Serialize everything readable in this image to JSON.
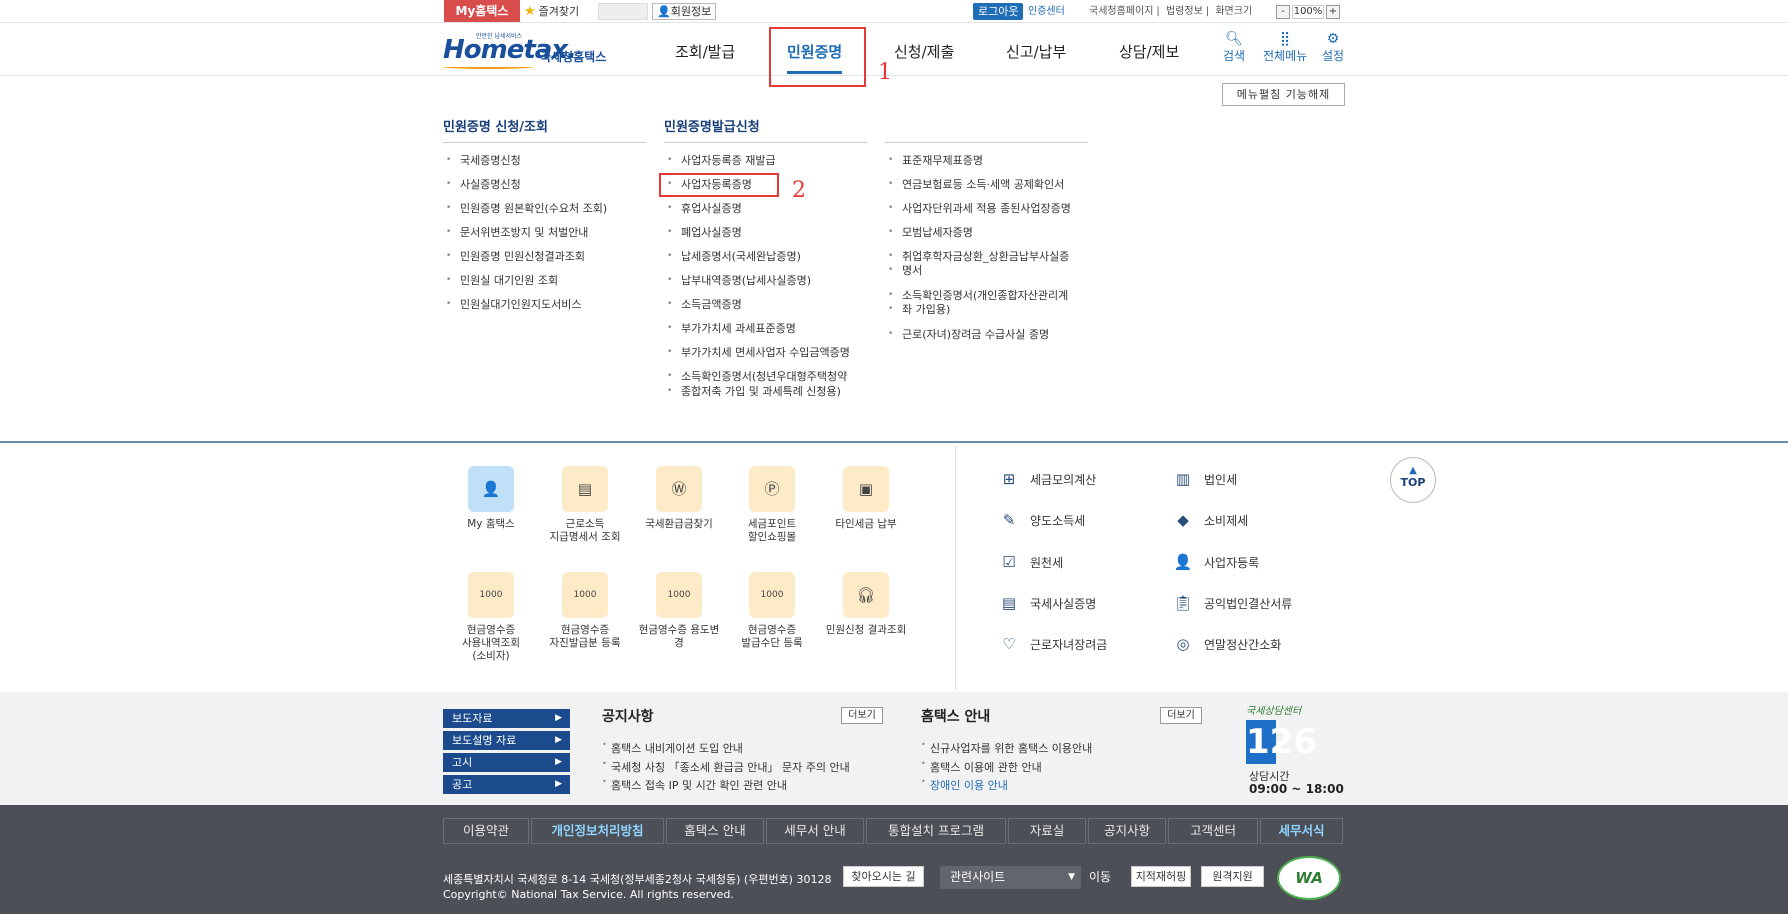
{
  "topbar": {
    "my_hometax": "My홈택스",
    "favorites": "즐겨찾기",
    "member_info": "회원정보",
    "logout": "로그아웃",
    "cert_center": "인증센터",
    "links": [
      "국세청홈페이지",
      "법령정보",
      "화면크기"
    ],
    "zoom_minus": "-",
    "zoom_value": "100%",
    "zoom_plus": "+"
  },
  "header": {
    "logo_text": "Hometax.",
    "logo_sub": "국세청홈택스",
    "logo_small": "만만한 납세서비스",
    "nav": [
      "조회/발급",
      "민원증명",
      "신청/제출",
      "신고/납부",
      "상담/제보"
    ],
    "active_nav": "민원증명",
    "icons": [
      {
        "label": "검색",
        "icon": "search-icon"
      },
      {
        "label": "전체메뉴",
        "icon": "grid-icon"
      },
      {
        "label": "설정",
        "icon": "gear-icon"
      }
    ],
    "annotation_1": "1"
  },
  "megamenu": {
    "collapse_label": "메뉴펼침 기능해제",
    "col1": {
      "title": "민원증명 신청/조회",
      "items": [
        "국세증명신청",
        "사실증명신청",
        "민원증명 원본확인(수요처 조회)",
        "문서위변조방지 및 처벌안내",
        "민원증명 민원신청결과조회",
        "민원실 대기인원 조회",
        "민원실대기인원지도서비스"
      ]
    },
    "col2": {
      "title": "민원증명발급신청",
      "items": [
        "사업자등록증 재발급",
        "사업자등록증명",
        "휴업사실증명",
        "폐업사실증명",
        "납세증명서(국세완납증명)",
        "납부내역증명(납세사실증명)",
        "소득금액증명",
        "부가가치세 과세표준증명",
        "부가가치세 면세사업자 수입금액증명",
        "소득확인증명서(청년우대형주택청약",
        "종합저축 가입 및 과세특례 신청용)"
      ]
    },
    "col3": {
      "items": [
        "표준재무제표증명",
        "연금보험료등 소득·세액 공제확인서",
        "사업자단위과세 적용 종된사업장증명",
        "모범납세자증명",
        "취업후학자금상환_상환금납부사실증",
        "명서",
        "소득확인증명서(개인종합자산관리계",
        "좌 가입용)",
        "근로(자녀)장려금 수급사실 증명"
      ]
    },
    "annotation_2": "2"
  },
  "quick": {
    "items": [
      {
        "label": "My 홈택스",
        "icon": "person-icon"
      },
      {
        "label": "근로소득\n지급명세서 조회",
        "icon": "document-won-icon"
      },
      {
        "label": "국세환급금찾기",
        "icon": "refund-icon"
      },
      {
        "label": "세금포인트\n할인쇼핑몰",
        "icon": "tax-point-icon"
      },
      {
        "label": "타인세금 납부",
        "icon": "pay-icon"
      },
      {
        "label": "현금영수증\n사용내역조회\n(소비자)",
        "icon": "receipt-icon"
      },
      {
        "label": "현금영수증\n자진발급분 등록",
        "icon": "receipt-icon"
      },
      {
        "label": "현금영수증 용도변\n경",
        "icon": "receipt-icon"
      },
      {
        "label": "현금영수증\n발급수단 등록",
        "icon": "receipt-icon"
      },
      {
        "label": "민원신청 결과조회",
        "icon": "headset-icon"
      }
    ],
    "receipt_text": "1000",
    "taxes": [
      {
        "label": "세금모의계산",
        "icon": "calculator-icon"
      },
      {
        "label": "법인세",
        "icon": "building-icon"
      },
      {
        "label": "양도소득세",
        "icon": "transfer-icon"
      },
      {
        "label": "소비제세",
        "icon": "diamond-icon"
      },
      {
        "label": "원천세",
        "icon": "checklist-icon"
      },
      {
        "label": "사업자등록",
        "icon": "person-icon"
      },
      {
        "label": "국세사실증명",
        "icon": "certificate-icon"
      },
      {
        "label": "공익법인결산서류",
        "icon": "clipboard-icon"
      },
      {
        "label": "근로자녀장려금",
        "icon": "heart-icon"
      },
      {
        "label": "연말정산간소화",
        "icon": "easy-icon"
      }
    ],
    "top_label": "TOP"
  },
  "news": {
    "press": [
      "보도자료",
      "보도설명 자료",
      "고시",
      "공고"
    ],
    "notice_title": "공지사항",
    "notice_more": "더보기",
    "notices": [
      "홈택스 내비게이션 도입 안내",
      "국세청 사칭 「종소세 환급금 안내」 문자 주의 안내",
      "홈택스 접속 IP 및 시간 확인 관련 안내"
    ],
    "guide_title": "홈택스 안내",
    "guide_more": "더보기",
    "guides": [
      "신규사업자를 위한 홈택스 이용안내",
      "홈택스 이용에 관한 안내",
      "장애인 이용 안내"
    ],
    "call_script": "국세상담센터",
    "call_number": "126",
    "call_label": "상담시간",
    "call_time": "09:00 ~ 18:00"
  },
  "footer": {
    "links": [
      "이용약관",
      "개인정보처리방침",
      "홈택스 안내",
      "세무서 안내",
      "통합설치 프로그램",
      "자료실",
      "공지사항",
      "고객센터",
      "세무서식"
    ],
    "address": "세종특별자치시 국세청로 8-14 국세청(정부세종2청사 국세청동) (우편번호) 30128",
    "directions": "찾아오시는 길",
    "copyright": "Copyright© National Tax Service. All rights reserved.",
    "related_sites": "관련사이트",
    "move": "이동",
    "btn1": "지적재허핑",
    "btn2": "원격지원",
    "wa": "WA"
  },
  "colors": {
    "brand_blue": "#1f6cb7",
    "navy": "#1b4b8c",
    "red_annotation": "#e53935",
    "footer_bg": "#4c4f55"
  }
}
